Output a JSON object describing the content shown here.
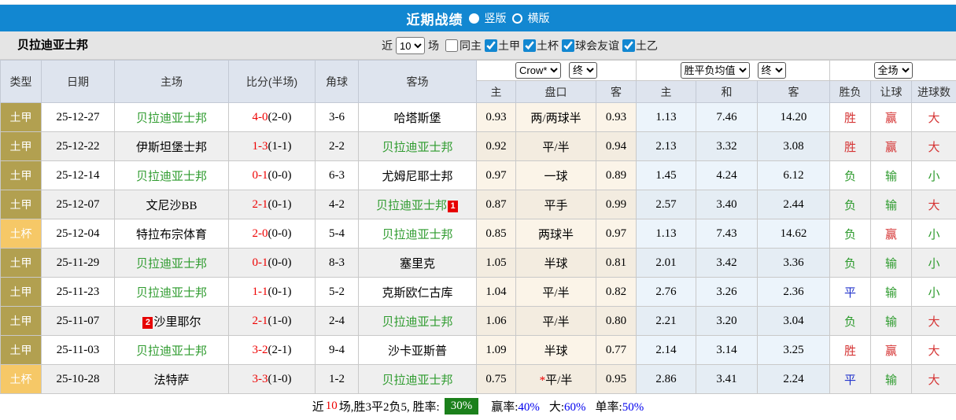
{
  "header": {
    "title": "近期战绩",
    "layout_options": [
      {
        "label": "竖版",
        "selected": true
      },
      {
        "label": "横版",
        "selected": false
      }
    ]
  },
  "filter_bar": {
    "team_name": "贝拉迪亚士邦",
    "recent_label": "近",
    "recent_count": "10",
    "matches_label": "场",
    "same_home": {
      "label": "同主",
      "checked": false
    },
    "leagues": [
      {
        "label": "土甲",
        "checked": true
      },
      {
        "label": "土杯",
        "checked": true
      },
      {
        "label": "球会友谊",
        "checked": true
      },
      {
        "label": "土乙",
        "checked": true
      }
    ]
  },
  "table": {
    "columns": [
      "类型",
      "日期",
      "主场",
      "比分(半场)",
      "角球",
      "客场"
    ],
    "odds_subcolumns": [
      "主",
      "盘口",
      "客"
    ],
    "avg_subcolumns": [
      "主",
      "和",
      "客"
    ],
    "result_subcolumns": [
      "胜负",
      "让球",
      "进球数"
    ],
    "selectors": {
      "odds_company": "Crow*",
      "odds_time": "终",
      "avg_type": "胜平负均值",
      "avg_time": "终",
      "scope": "全场"
    },
    "rows": [
      {
        "type": "土甲",
        "cup": false,
        "date": "25-12-27",
        "home": "贝拉迪亚士邦",
        "home_green": true,
        "home_badge": "",
        "score": "4-0",
        "half": "(2-0)",
        "corners": "3-6",
        "away": "哈塔斯堡",
        "away_green": false,
        "away_badge": "",
        "odds_home": "0.93",
        "handicap": "两/两球半",
        "handicap_star": false,
        "odds_away": "0.93",
        "avg_win": "1.13",
        "avg_draw": "7.46",
        "avg_lose": "14.20",
        "result": "胜",
        "result_color": "red",
        "spread": "赢",
        "spread_color": "red",
        "goals": "大",
        "goals_color": "red"
      },
      {
        "type": "土甲",
        "cup": false,
        "date": "25-12-22",
        "home": "伊斯坦堡士邦",
        "home_green": false,
        "home_badge": "",
        "score": "1-3",
        "half": "(1-1)",
        "corners": "2-2",
        "away": "贝拉迪亚士邦",
        "away_green": true,
        "away_badge": "",
        "odds_home": "0.92",
        "handicap": "平/半",
        "handicap_star": false,
        "odds_away": "0.94",
        "avg_win": "2.13",
        "avg_draw": "3.32",
        "avg_lose": "3.08",
        "result": "胜",
        "result_color": "red",
        "spread": "赢",
        "spread_color": "red",
        "goals": "大",
        "goals_color": "red"
      },
      {
        "type": "土甲",
        "cup": false,
        "date": "25-12-14",
        "home": "贝拉迪亚士邦",
        "home_green": true,
        "home_badge": "",
        "score": "0-1",
        "half": "(0-0)",
        "corners": "6-3",
        "away": "尤姆尼耶士邦",
        "away_green": false,
        "away_badge": "",
        "odds_home": "0.97",
        "handicap": "一球",
        "handicap_star": false,
        "odds_away": "0.89",
        "avg_win": "1.45",
        "avg_draw": "4.24",
        "avg_lose": "6.12",
        "result": "负",
        "result_color": "green",
        "spread": "输",
        "spread_color": "green",
        "goals": "小",
        "goals_color": "green"
      },
      {
        "type": "土甲",
        "cup": false,
        "date": "25-12-07",
        "home": "文尼沙BB",
        "home_green": false,
        "home_badge": "",
        "score": "2-1",
        "half": "(0-1)",
        "corners": "4-2",
        "away": "贝拉迪亚士邦",
        "away_green": true,
        "away_badge": "1",
        "odds_home": "0.87",
        "handicap": "平手",
        "handicap_star": false,
        "odds_away": "0.99",
        "avg_win": "2.57",
        "avg_draw": "3.40",
        "avg_lose": "2.44",
        "result": "负",
        "result_color": "green",
        "spread": "输",
        "spread_color": "green",
        "goals": "大",
        "goals_color": "red"
      },
      {
        "type": "土杯",
        "cup": true,
        "date": "25-12-04",
        "home": "特拉布宗体育",
        "home_green": false,
        "home_badge": "",
        "score": "2-0",
        "half": "(0-0)",
        "corners": "5-4",
        "away": "贝拉迪亚士邦",
        "away_green": true,
        "away_badge": "",
        "odds_home": "0.85",
        "handicap": "两球半",
        "handicap_star": false,
        "odds_away": "0.97",
        "avg_win": "1.13",
        "avg_draw": "7.43",
        "avg_lose": "14.62",
        "result": "负",
        "result_color": "green",
        "spread": "赢",
        "spread_color": "red",
        "goals": "小",
        "goals_color": "green"
      },
      {
        "type": "土甲",
        "cup": false,
        "date": "25-11-29",
        "home": "贝拉迪亚士邦",
        "home_green": true,
        "home_badge": "",
        "score": "0-1",
        "half": "(0-0)",
        "corners": "8-3",
        "away": "塞里克",
        "away_green": false,
        "away_badge": "",
        "odds_home": "1.05",
        "handicap": "半球",
        "handicap_star": false,
        "odds_away": "0.81",
        "avg_win": "2.01",
        "avg_draw": "3.42",
        "avg_lose": "3.36",
        "result": "负",
        "result_color": "green",
        "spread": "输",
        "spread_color": "green",
        "goals": "小",
        "goals_color": "green"
      },
      {
        "type": "土甲",
        "cup": false,
        "date": "25-11-23",
        "home": "贝拉迪亚士邦",
        "home_green": true,
        "home_badge": "",
        "score": "1-1",
        "half": "(0-1)",
        "corners": "5-2",
        "away": "克斯欧仁古库",
        "away_green": false,
        "away_badge": "",
        "odds_home": "1.04",
        "handicap": "平/半",
        "handicap_star": false,
        "odds_away": "0.82",
        "avg_win": "2.76",
        "avg_draw": "3.26",
        "avg_lose": "2.36",
        "result": "平",
        "result_color": "blue",
        "spread": "输",
        "spread_color": "green",
        "goals": "小",
        "goals_color": "green"
      },
      {
        "type": "土甲",
        "cup": false,
        "date": "25-11-07",
        "home": "沙里耶尔",
        "home_green": false,
        "home_badge": "2",
        "score": "2-1",
        "half": "(1-0)",
        "corners": "2-4",
        "away": "贝拉迪亚士邦",
        "away_green": true,
        "away_badge": "",
        "odds_home": "1.06",
        "handicap": "平/半",
        "handicap_star": false,
        "odds_away": "0.80",
        "avg_win": "2.21",
        "avg_draw": "3.20",
        "avg_lose": "3.04",
        "result": "负",
        "result_color": "green",
        "spread": "输",
        "spread_color": "green",
        "goals": "大",
        "goals_color": "red"
      },
      {
        "type": "土甲",
        "cup": false,
        "date": "25-11-03",
        "home": "贝拉迪亚士邦",
        "home_green": true,
        "home_badge": "",
        "score": "3-2",
        "half": "(2-1)",
        "corners": "9-4",
        "away": "沙卡亚斯普",
        "away_green": false,
        "away_badge": "",
        "odds_home": "1.09",
        "handicap": "半球",
        "handicap_star": false,
        "odds_away": "0.77",
        "avg_win": "2.14",
        "avg_draw": "3.14",
        "avg_lose": "3.25",
        "result": "胜",
        "result_color": "red",
        "spread": "赢",
        "spread_color": "red",
        "goals": "大",
        "goals_color": "red"
      },
      {
        "type": "土杯",
        "cup": true,
        "date": "25-10-28",
        "home": "法特萨",
        "home_green": false,
        "home_badge": "",
        "score": "3-3",
        "half": "(1-0)",
        "corners": "1-2",
        "away": "贝拉迪亚士邦",
        "away_green": true,
        "away_badge": "",
        "odds_home": "0.75",
        "handicap": "平/半",
        "handicap_star": true,
        "odds_away": "0.95",
        "avg_win": "2.86",
        "avg_draw": "3.41",
        "avg_lose": "2.24",
        "result": "平",
        "result_color": "blue",
        "spread": "输",
        "spread_color": "green",
        "goals": "大",
        "goals_color": "red"
      }
    ]
  },
  "footer": {
    "prefix": "近",
    "count": "10",
    "mid": "场,胜3平2负5, 胜率:",
    "win_rate": "30%",
    "stats": [
      {
        "label": "赢率:",
        "value": "40%"
      },
      {
        "label": "大:",
        "value": "60%"
      },
      {
        "label": "单率:",
        "value": "50%"
      }
    ]
  },
  "colors": {
    "brand_blue": "#1287d1",
    "gold_league": "#b2a050",
    "gold_cup": "#f6c867",
    "score_red": "#ee0000",
    "res_red": "#d53333",
    "green": "#2e9b2e",
    "res_blue": "#2233cc",
    "pct_blue": "#0000ee",
    "winrate_green": "#1b801b",
    "badge_red": "#e60000"
  }
}
